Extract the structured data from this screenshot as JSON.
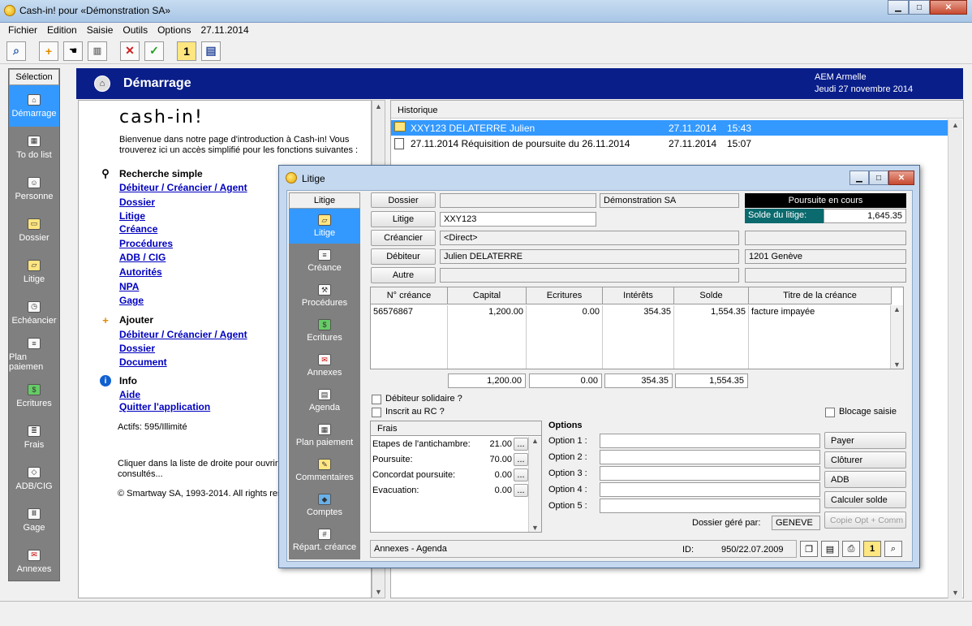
{
  "window": {
    "title": "Cash-in! pour «Démonstration SA»",
    "minimize": "▁",
    "maximize": "□",
    "close": "✕"
  },
  "menu": [
    "Fichier",
    "Edition",
    "Saisie",
    "Outils",
    "Options",
    "27.11.2014"
  ],
  "toolbar": {
    "icons": [
      "search-window-icon",
      "add-icon",
      "hand-pointer-icon",
      "trash-icon",
      "cancel-icon",
      "check-icon",
      "info-icon",
      "notebook-icon"
    ]
  },
  "sidebar": {
    "header": "Sélection",
    "items": [
      {
        "label": "Démarrage",
        "icon": "home-icon",
        "selected": true
      },
      {
        "label": "To do list",
        "icon": "calendar-icon"
      },
      {
        "label": "Personne",
        "icon": "person-icon"
      },
      {
        "label": "Dossier",
        "icon": "folder-icon"
      },
      {
        "label": "Litige",
        "icon": "folder-open-icon"
      },
      {
        "label": "Echéancier",
        "icon": "clock-icon"
      },
      {
        "label": "Plan paiemen",
        "icon": "document-icon"
      },
      {
        "label": "Ecritures",
        "icon": "money-icon"
      },
      {
        "label": "Frais",
        "icon": "invoice-icon"
      },
      {
        "label": "ADB/CIG",
        "icon": "tag-icon"
      },
      {
        "label": "Gage",
        "icon": "columns-icon"
      },
      {
        "label": "Annexes",
        "icon": "attachment-icon"
      }
    ]
  },
  "header": {
    "title": "Démarrage",
    "user": "AEM Armelle",
    "date": "Jeudi 27 novembre 2014"
  },
  "start": {
    "logo": "cash-in!",
    "intro": "Bienvenue dans notre page d'introduction à Cash-in! Vous trouverez ici un accès simplifié pour les fonctions suivantes :",
    "search_title": "Recherche simple",
    "search_links": [
      "Débiteur / Créancier / Agent",
      "Dossier",
      "Litige",
      "Créance",
      "Procédures",
      "ADB / CIG",
      "Autorités",
      "NPA",
      "Gage"
    ],
    "add_title": "Ajouter",
    "add_links": [
      "Débiteur / Créancier / Agent",
      "Dossier",
      "Document"
    ],
    "info_title": "Info",
    "info_links": [
      "Aide",
      "Quitter l'application"
    ],
    "actifs": "Actifs: 595/Illimité",
    "click_hint": "Cliquer dans la liste de droite pour ouvrir les derniers objets consultés...",
    "copyright": "© Smartway SA, 1993-2014. All rights reserved."
  },
  "history": {
    "header": "Historique",
    "rows": [
      {
        "text": "XXY123 DELATERRE Julien",
        "date": "27.11.2014",
        "time": "15:43",
        "icon": "folder-icon",
        "selected": true
      },
      {
        "text": "27.11.2014 Réquisition de poursuite du 26.11.2014",
        "date": "27.11.2014",
        "time": "15:07",
        "icon": "document-icon"
      }
    ]
  },
  "dialog": {
    "title": "Litige",
    "nav_header": "Litige",
    "nav": [
      {
        "label": "Litige",
        "icon": "folder-open-icon",
        "selected": true
      },
      {
        "label": "Créance",
        "icon": "document-icon"
      },
      {
        "label": "Procédures",
        "icon": "hammer-icon"
      },
      {
        "label": "Ecritures",
        "icon": "money-icon"
      },
      {
        "label": "Annexes",
        "icon": "attachment-icon"
      },
      {
        "label": "Agenda",
        "icon": "agenda-icon"
      },
      {
        "label": "Plan paiement",
        "icon": "calculator-icon"
      },
      {
        "label": "Commentaires",
        "icon": "note-icon"
      },
      {
        "label": "Comptes",
        "icon": "book-icon"
      },
      {
        "label": "Répart. créance",
        "icon": "grid-icon"
      }
    ],
    "buttons": {
      "dossier": "Dossier",
      "litige": "Litige",
      "creancier": "Créancier",
      "debiteur": "Débiteur",
      "autre": "Autre"
    },
    "fields": {
      "dossier": "",
      "dossier_company": "Démonstration SA",
      "litige": "XXY123",
      "creancier": "<Direct>",
      "debiteur": "Julien DELATERRE",
      "debiteur_city": "1201 Genève",
      "autre": ""
    },
    "status": {
      "label": "Poursuite en cours",
      "solde_label": "Solde du litige:",
      "solde_value": "1,645.35"
    },
    "claims": {
      "columns": [
        "N° créance",
        "Capital",
        "Ecritures",
        "Intérêts",
        "Solde",
        "Titre de la créance"
      ],
      "rows": [
        [
          "56576867",
          "1,200.00",
          "0.00",
          "354.35",
          "1,554.35",
          "facture impayée"
        ]
      ],
      "totals": [
        "1,200.00",
        "0.00",
        "354.35",
        "1,554.35"
      ]
    },
    "checks": {
      "solidaire": "Débiteur solidaire ?",
      "rc": "Inscrit au RC ?",
      "blocage": "Blocage saisie"
    },
    "frais": {
      "header": "Frais",
      "rows": [
        {
          "label": "Etapes de l'antichambre:",
          "value": "21.00"
        },
        {
          "label": "Poursuite:",
          "value": "70.00"
        },
        {
          "label": "Concordat poursuite:",
          "value": "0.00"
        },
        {
          "label": "Evacuation:",
          "value": "0.00"
        }
      ],
      "more": "..."
    },
    "options": {
      "title": "Options",
      "labels": [
        "Option 1 :",
        "Option 2 :",
        "Option 3 :",
        "Option 4 :",
        "Option 5 :"
      ],
      "values": [
        "",
        "",
        "",
        "",
        ""
      ]
    },
    "actions": [
      "Payer",
      "Clôturer",
      "ADB",
      "Calculer solde",
      "Copie Opt + Comm"
    ],
    "gere_label": "Dossier géré par:",
    "gere_value": "GENEVE",
    "footer": {
      "annexes": "Annexes - Agenda",
      "id_label": "ID:",
      "id_value": "950/22.07.2009"
    },
    "footer_icons": [
      "copy-icon",
      "list-icon",
      "print-icon",
      "info-icon",
      "window-search-icon"
    ]
  }
}
